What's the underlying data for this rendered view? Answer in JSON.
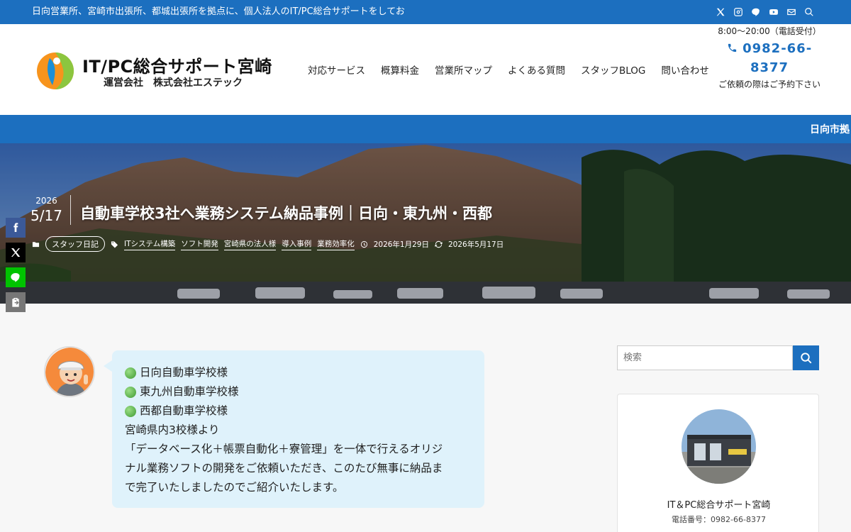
{
  "topbar": {
    "message": "日向営業所、宮崎市出張所、都城出張所を拠点に、個人法人のIT/PC総合サポートをしてお",
    "icons": [
      "x-icon",
      "instagram-icon",
      "line-icon",
      "youtube-icon",
      "mail-icon",
      "search-icon"
    ]
  },
  "logo": {
    "title": "IT/PC総合サポート宮崎",
    "subtitle": "運営会社　株式会社エステック"
  },
  "nav": {
    "items": [
      "対応サービス",
      "概算料金",
      "営業所マップ",
      "よくある質問",
      "スタッフBLOG",
      "問い合わせ"
    ]
  },
  "contact": {
    "hours": "8:00～20:00（電話受付）",
    "phone": "0982-66-8377",
    "note": "ご依頼の際はご予約下さい"
  },
  "band": {
    "marquee": "日向市拠"
  },
  "post": {
    "year": "2026",
    "monthday": "5/17",
    "title": "自動車学校3社へ業務システム納品事例｜日向・東九州・西都",
    "category": "スタッフ日記",
    "tags": [
      "ITシステム構築",
      "ソフト開発",
      "宮崎県の法人様",
      "導入事例",
      "業務効率化"
    ],
    "published": "2026年1月29日",
    "updated": "2026年5月17日"
  },
  "bubble": {
    "items": [
      "日向自動車学校様",
      "東九州自動車学校様",
      "西都自動車学校様"
    ],
    "lines": [
      "宮崎県内3校様より",
      "「データベース化＋帳票自動化＋寮管理」を一体で行えるオリジ",
      "ナル業務ソフトの開発をご依頼いただき、このたび無事に納品ま",
      "で完了いたしましたのでご紹介いたします。"
    ]
  },
  "sidebar": {
    "search_placeholder": "検索",
    "profile_name": "IT＆PC総合サポート宮崎",
    "profile_tel": "電話番号：0982-66-8377"
  },
  "colors": {
    "brand_blue": "#1c6fbf",
    "bubble_bg": "#dff2fb",
    "facebook": "#3b5998",
    "x": "#000000",
    "line": "#00c300",
    "copy": "#777777"
  }
}
